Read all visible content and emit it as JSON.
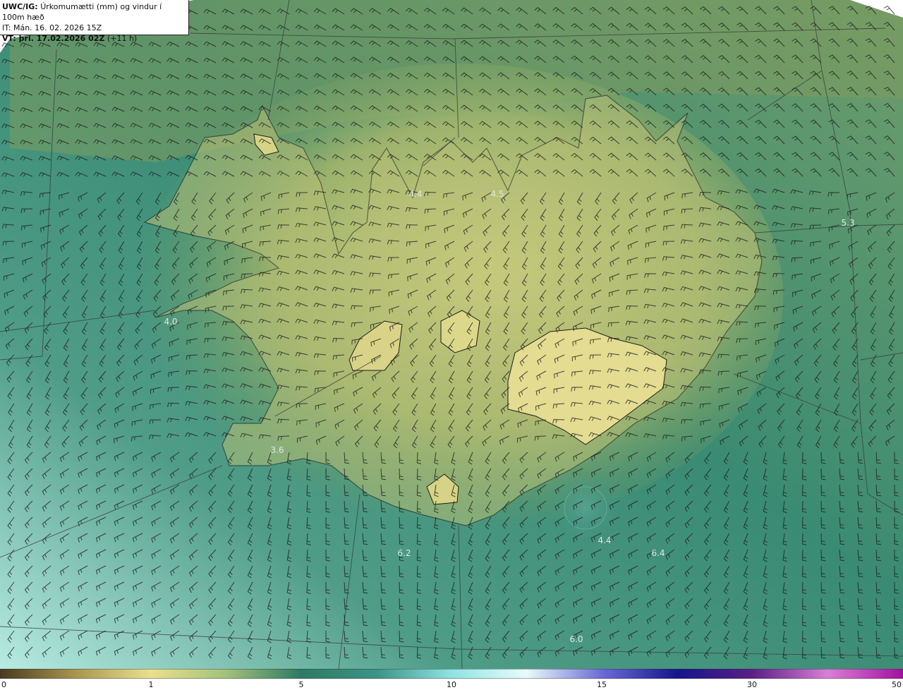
{
  "header": {
    "line1_prefix": "UWC/IG:",
    "line1_text": "Úrkomumætti (mm) og vindur í 100m hæð",
    "line2": "IT: Mán. 16. 02. 2026 15Z",
    "line3_prefix": "VT: þri. 17.02.2026 02Z",
    "line3_suffix": "(+11 h)"
  },
  "map_labels": [
    {
      "id": "lbl-1",
      "text": "4.4"
    },
    {
      "id": "lbl-2",
      "text": "4.5"
    },
    {
      "id": "lbl-3",
      "text": "5.3"
    },
    {
      "id": "lbl-4",
      "text": "4.0"
    },
    {
      "id": "lbl-5",
      "text": "3.6"
    },
    {
      "id": "lbl-6",
      "text": "6.2"
    },
    {
      "id": "lbl-7",
      "text": "4.4"
    },
    {
      "id": "lbl-8",
      "text": "6.4"
    },
    {
      "id": "lbl-9",
      "text": "6.0"
    }
  ],
  "colorbar": {
    "ticks": [
      "0",
      "1",
      "5",
      "10",
      "15",
      "30",
      "50"
    ],
    "colors": [
      "#4a3a1e",
      "#a89550",
      "#e9e08e",
      "#a3c27c",
      "#2e7a63",
      "#3b9486",
      "#8fe3e3",
      "#e9fbfb",
      "#6b6bd6",
      "#15168a",
      "#5a1f86",
      "#d97fd6",
      "#a3119f"
    ]
  }
}
